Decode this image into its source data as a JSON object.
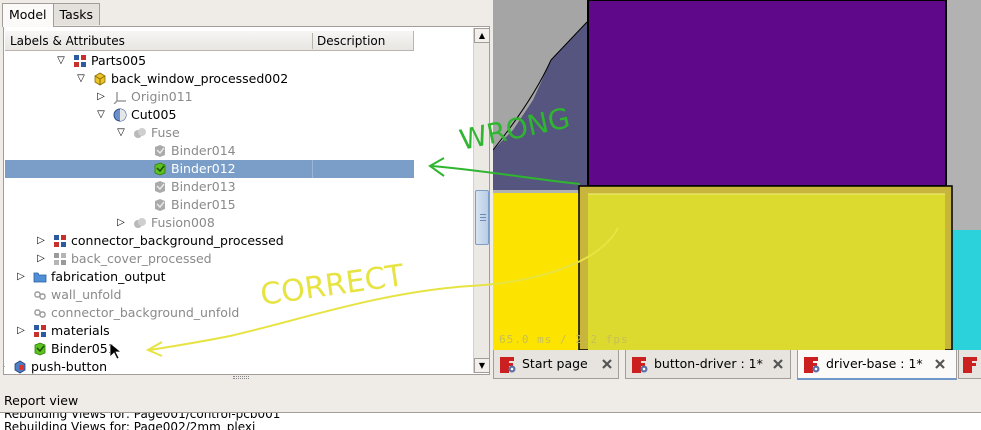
{
  "left_panel": {
    "tabs": [
      {
        "label": "Model",
        "active": true
      },
      {
        "label": "Tasks",
        "active": false
      }
    ],
    "columns": {
      "labels": "Labels & Attributes",
      "description": "Description"
    }
  },
  "tree": [
    {
      "label": "Parts005",
      "icon": "assembly-icon",
      "arrow": "down",
      "gray": false
    },
    {
      "label": "back_window_processed002",
      "icon": "part-icon",
      "arrow": "down",
      "gray": false
    },
    {
      "label": "Origin011",
      "icon": "origin-icon",
      "arrow": "right",
      "gray": true
    },
    {
      "label": "Cut005",
      "icon": "cut-icon",
      "arrow": "down",
      "gray": false
    },
    {
      "label": "Fuse",
      "icon": "fuse-icon",
      "arrow": "down",
      "gray": true
    },
    {
      "label": "Binder014",
      "icon": "binder-icon",
      "arrow": "",
      "gray": true
    },
    {
      "label": "Binder012",
      "icon": "binder-green-icon",
      "arrow": "",
      "gray": false,
      "selected": true
    },
    {
      "label": "Binder013",
      "icon": "binder-icon",
      "arrow": "",
      "gray": true
    },
    {
      "label": "Binder015",
      "icon": "binder-icon",
      "arrow": "",
      "gray": true
    },
    {
      "label": "Fusion008",
      "icon": "fusion-icon",
      "arrow": "right",
      "gray": true
    },
    {
      "label": "connector_background_processed",
      "icon": "assembly-icon",
      "arrow": "right",
      "gray": false
    },
    {
      "label": "back_cover_processed",
      "icon": "assembly-gray-icon",
      "arrow": "right",
      "gray": true
    },
    {
      "label": "fabrication_output",
      "icon": "folder-icon",
      "arrow": "right",
      "gray": false
    },
    {
      "label": "wall_unfold",
      "icon": "link-icon",
      "arrow": "",
      "gray": true
    },
    {
      "label": "connector_background_unfold",
      "icon": "link-icon",
      "arrow": "",
      "gray": true
    },
    {
      "label": "materials",
      "icon": "assembly-icon",
      "arrow": "right",
      "gray": false
    },
    {
      "label": "Binder051",
      "icon": "binder-green-icon",
      "arrow": "",
      "gray": false
    },
    {
      "label": "push-button",
      "icon": "body-icon",
      "arrow": "right",
      "gray": false
    }
  ],
  "view": {
    "fps_text": "65.0 ms / 2.2 fps",
    "colors": {
      "purple": "#5f098a",
      "yellow": "#dcda2f",
      "bright_yellow": "#fde400",
      "cyan": "#2bd2dc",
      "gray": "#b2b2b2"
    }
  },
  "doc_tabs": [
    {
      "label": "Start page",
      "active": false
    },
    {
      "label": "button-driver : 1*",
      "active": false
    },
    {
      "label": "driver-base : 1*",
      "active": true
    }
  ],
  "report": {
    "title": "Report view",
    "lines": [
      "Rebuilding Views for: Page001/control-pcb001",
      "Rebuilding Views for: Page002/2mm_plexi"
    ]
  },
  "annotations": {
    "wrong": "WRONG",
    "correct": "CORRECT"
  }
}
